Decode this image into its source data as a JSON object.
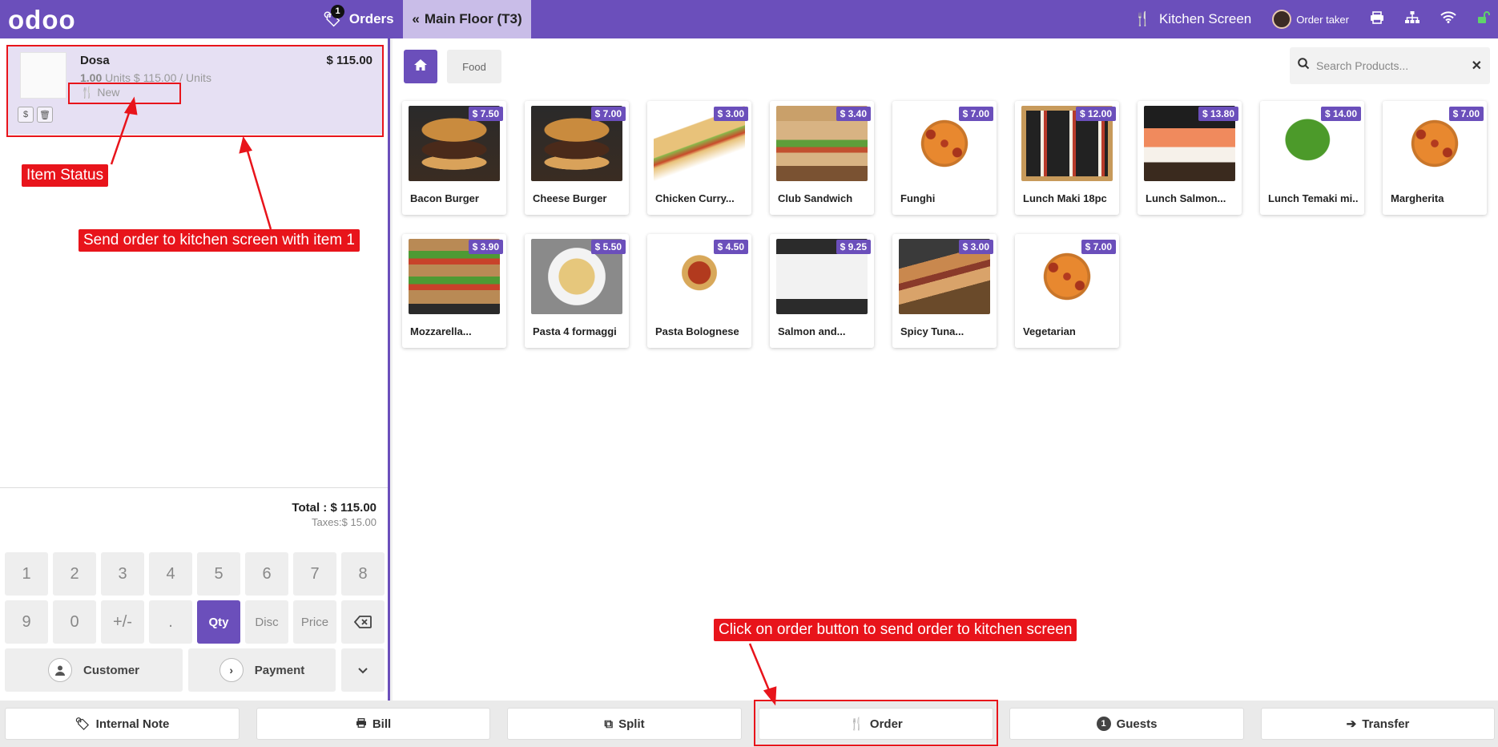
{
  "topbar": {
    "logo": "odoo",
    "orders_label": "Orders",
    "orders_count": "1",
    "floor_label": "Main Floor (T3)",
    "kitchen_label": "Kitchen Screen",
    "user_name": "Order taker"
  },
  "order": {
    "line": {
      "name": "Dosa",
      "price": "$ 115.00",
      "qty": "1.00",
      "unit_detail": "Units $ 115.00 / Units",
      "status": "New"
    },
    "total": "Total : $ 115.00",
    "taxes": "Taxes:$ 15.00"
  },
  "numpad": [
    "1",
    "2",
    "3",
    "4",
    "5",
    "6",
    "7",
    "8",
    "9",
    "0",
    "+/-",
    ".",
    "Qty",
    "Disc",
    "Price",
    "⌫"
  ],
  "actions": {
    "customer": "Customer",
    "payment": "Payment"
  },
  "products": {
    "category": "Food",
    "search_placeholder": "Search Products...",
    "items": [
      {
        "name": "Bacon Burger",
        "price": "$ 7.50",
        "img": "burger"
      },
      {
        "name": "Cheese Burger",
        "price": "$ 7.00",
        "img": "burger"
      },
      {
        "name": "Chicken Curry...",
        "price": "$ 3.00",
        "img": "sandwich"
      },
      {
        "name": "Club Sandwich",
        "price": "$ 3.40",
        "img": "sub"
      },
      {
        "name": "Funghi",
        "price": "$ 7.00",
        "img": "pizza"
      },
      {
        "name": "Lunch Maki 18pc",
        "price": "$ 12.00",
        "img": "maki"
      },
      {
        "name": "Lunch Salmon...",
        "price": "$ 13.80",
        "img": "salmon"
      },
      {
        "name": "Lunch Temaki mi...",
        "price": "$ 14.00",
        "img": "temaki"
      },
      {
        "name": "Margherita",
        "price": "$ 7.00",
        "img": "pizza"
      },
      {
        "name": "Mozzarella...",
        "price": "$ 3.90",
        "img": "mozza"
      },
      {
        "name": "Pasta 4 formaggi",
        "price": "$ 5.50",
        "img": "pasta"
      },
      {
        "name": "Pasta Bolognese",
        "price": "$ 4.50",
        "img": "bolognese"
      },
      {
        "name": "Salmon and...",
        "price": "$ 9.25",
        "img": "salmonrice"
      },
      {
        "name": "Spicy Tuna...",
        "price": "$ 3.00",
        "img": "tuna"
      },
      {
        "name": "Vegetarian",
        "price": "$ 7.00",
        "img": "pizza"
      }
    ]
  },
  "bottombar": {
    "internal_note": "Internal Note",
    "bill": "Bill",
    "split": "Split",
    "order": "Order",
    "guests_count": "1",
    "guests": "Guests",
    "transfer": "Transfer"
  },
  "annotations": {
    "item_status": "Item Status",
    "send_order": "Send order to kitchen screen with item 1",
    "click_order": "Click on order button to send order to kitchen screen"
  },
  "colors": {
    "brand": "#6b4fbb",
    "annotation": "#e8141b",
    "selected_line": "#e6e0f3"
  }
}
